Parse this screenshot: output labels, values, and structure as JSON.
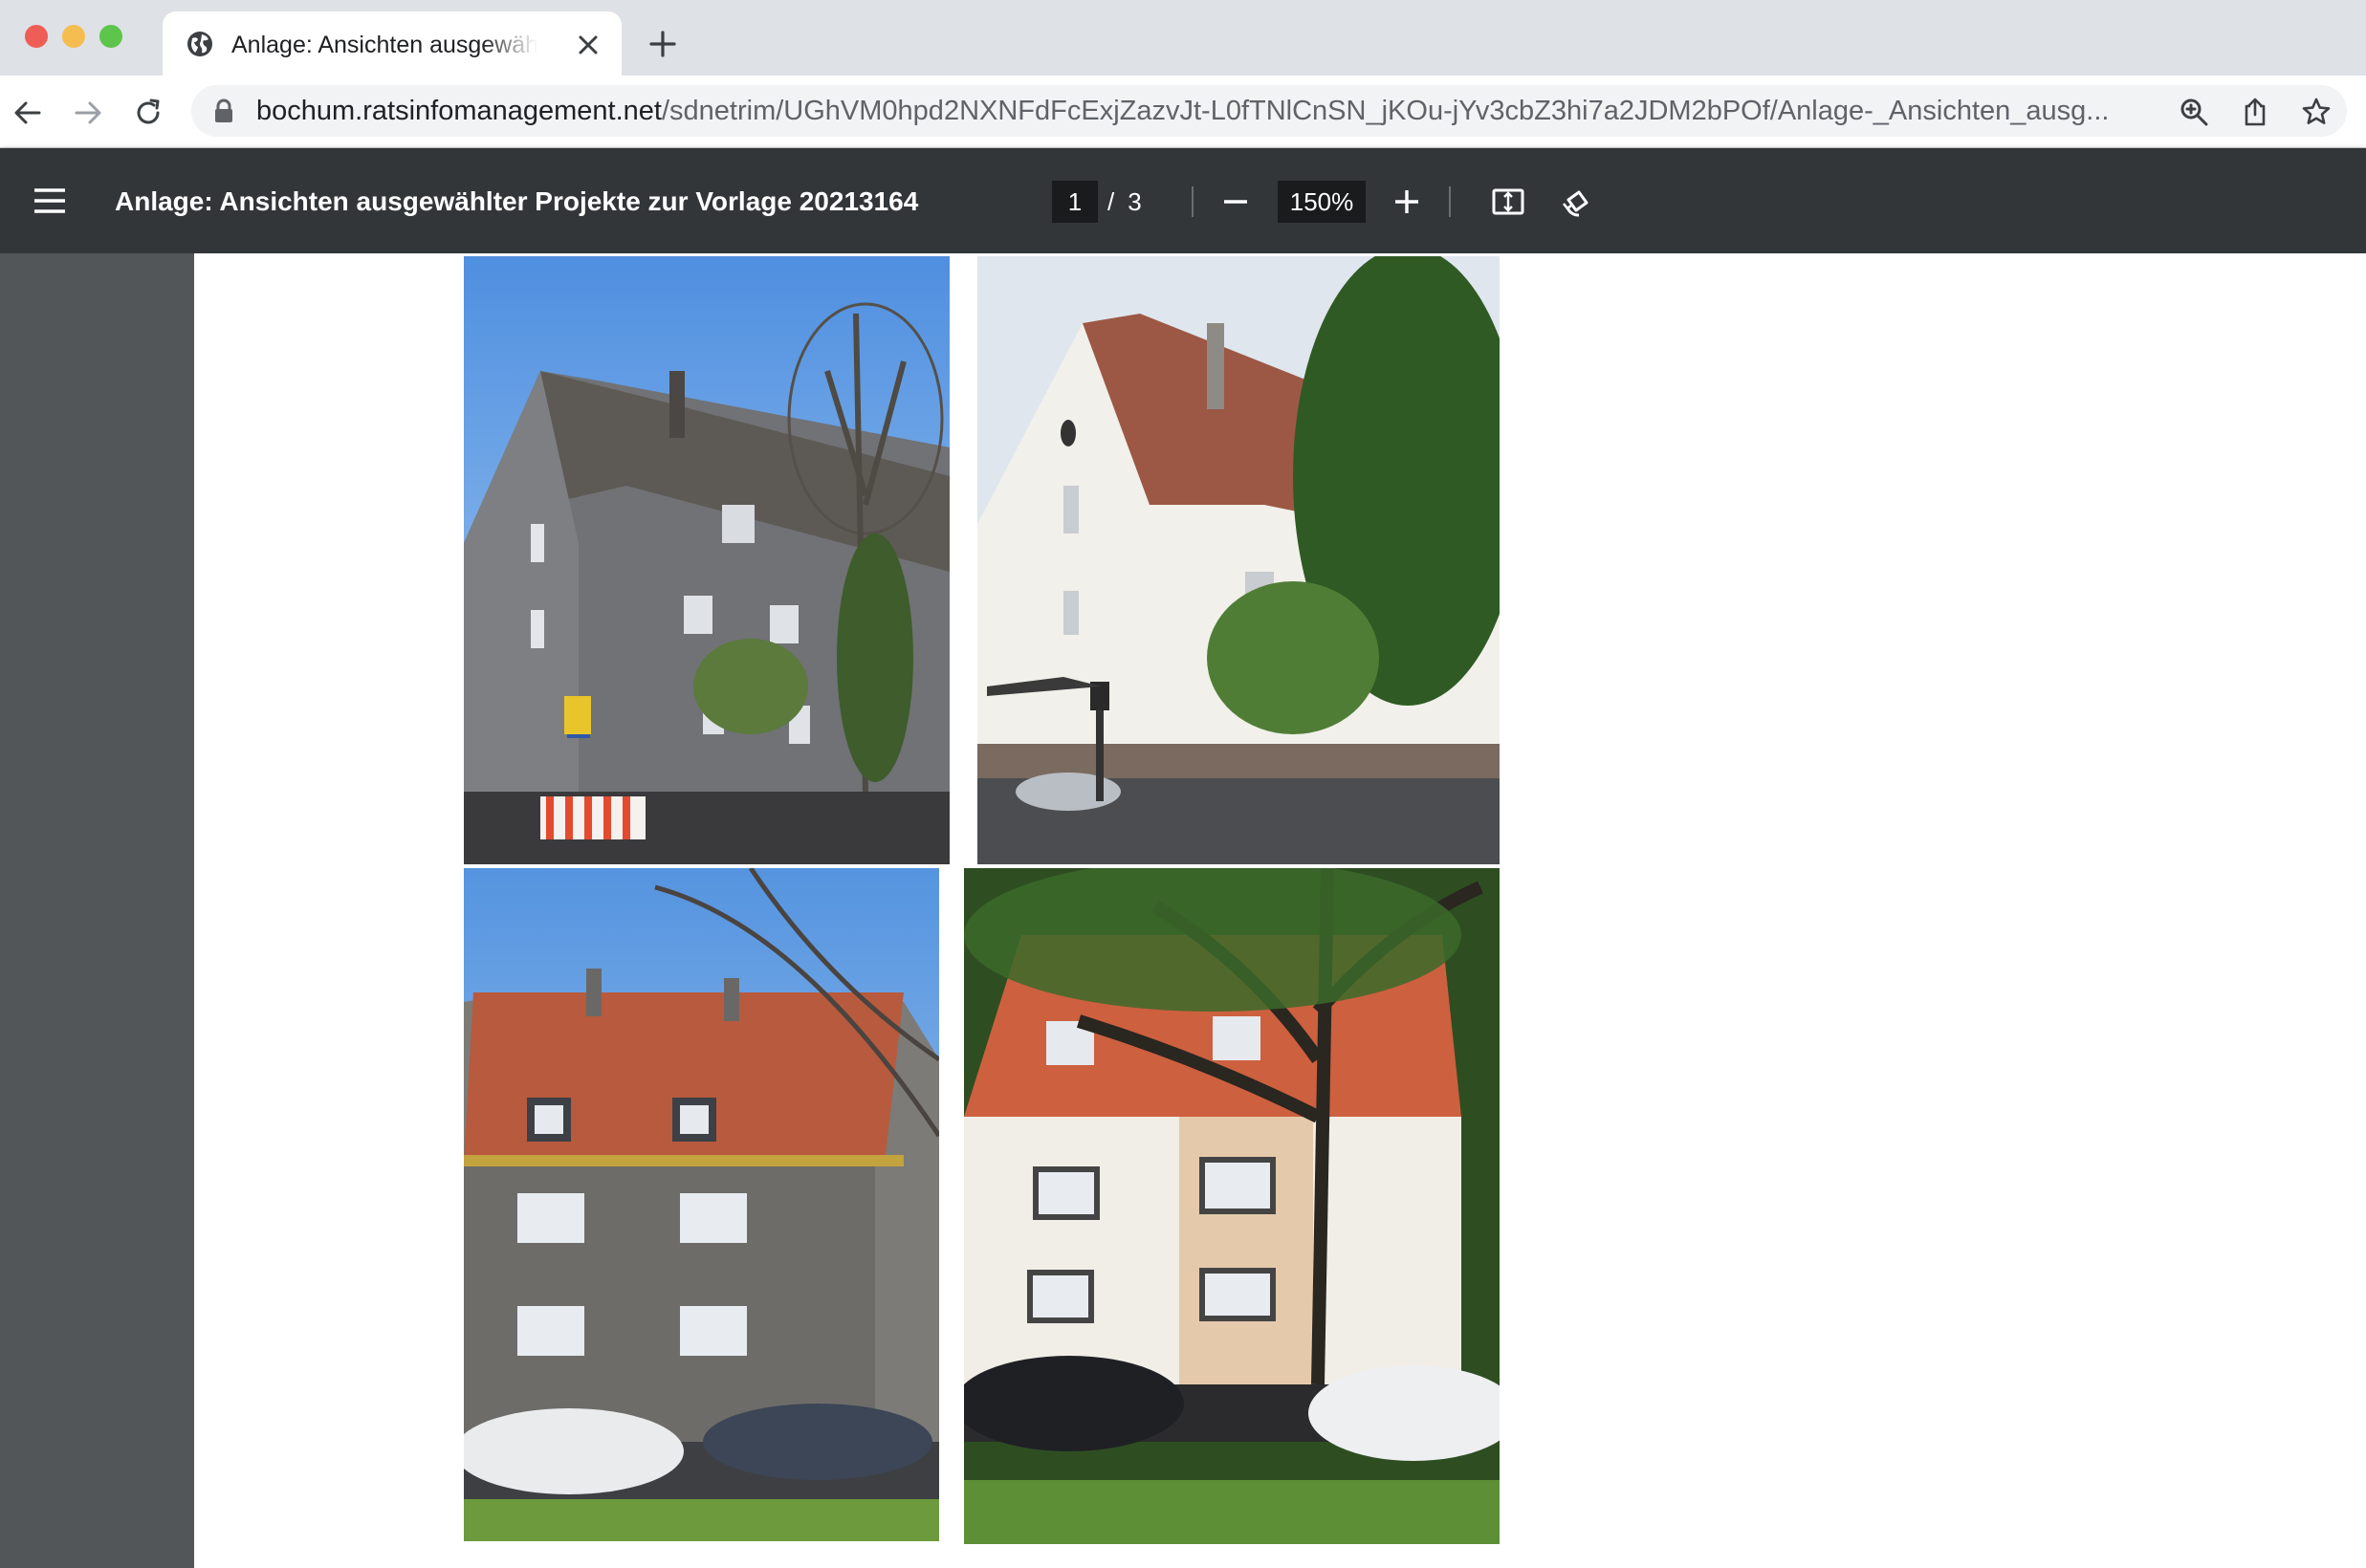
{
  "browser": {
    "tab": {
      "title": "Anlage: Ansichten ausgewählter Projekte zur Vorlage 20213164",
      "icon": "globe-icon"
    },
    "url": {
      "host": "bochum.ratsinfomanagement.net",
      "path": "/sdnetrim/UGhVM0hpd2NXNFdFcExjZazvJt-L0fTNlCnSN_jKOu-jYv3cbZ3hi7a2JDM2bPOf/Anlage-_Ansichten_ausg..."
    }
  },
  "pdf_viewer": {
    "title": "Anlage: Ansichten ausgewählter Projekte zur Vorlage 20213164",
    "current_page": "1",
    "page_separator": "/",
    "total_pages": "3",
    "zoom": "150%"
  },
  "colors": {
    "tabstrip": "#dee1e6",
    "pdf_toolbar": "#323639",
    "viewer_bg": "#525659",
    "page": "#ffffff"
  },
  "photos": [
    {
      "name": "gray-house-with-tree"
    },
    {
      "name": "white-house-with-trees"
    },
    {
      "name": "gray-house-red-roof"
    },
    {
      "name": "white-beige-house-with-tree"
    }
  ]
}
